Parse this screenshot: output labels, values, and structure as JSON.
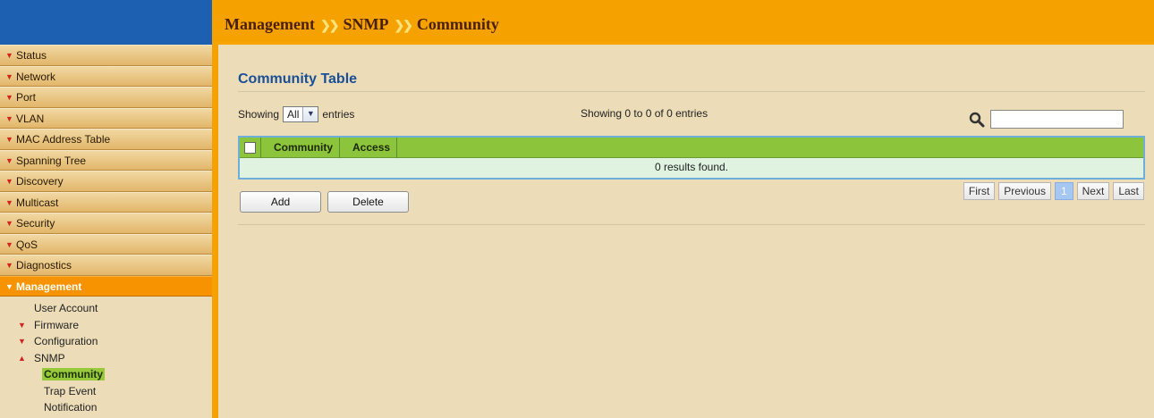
{
  "header": {
    "breadcrumb": [
      "Management",
      "SNMP",
      "Community"
    ]
  },
  "sidebar": {
    "items": [
      {
        "label": "Status"
      },
      {
        "label": "Network"
      },
      {
        "label": "Port"
      },
      {
        "label": "VLAN"
      },
      {
        "label": "MAC Address Table"
      },
      {
        "label": "Spanning Tree"
      },
      {
        "label": "Discovery"
      },
      {
        "label": "Multicast"
      },
      {
        "label": "Security"
      },
      {
        "label": "QoS"
      },
      {
        "label": "Diagnostics"
      },
      {
        "label": "Management"
      }
    ],
    "management_sub": {
      "user_account": "User Account",
      "firmware": "Firmware",
      "configuration": "Configuration",
      "snmp": "SNMP",
      "snmp_sub": {
        "community": "Community",
        "trap_event": "Trap Event",
        "notification": "Notification"
      }
    }
  },
  "main": {
    "title": "Community Table",
    "showing_prefix": "Showing",
    "page_size": "All",
    "entries_suffix": "entries",
    "showing_info": "Showing 0 to 0 of 0 entries",
    "search_value": "",
    "table": {
      "columns": [
        "Community",
        "Access"
      ],
      "empty_message": "0 results found."
    },
    "buttons": {
      "add": "Add",
      "delete": "Delete"
    },
    "pager": {
      "first": "First",
      "previous": "Previous",
      "current": "1",
      "next": "Next",
      "last": "Last"
    }
  },
  "colors": {
    "header_orange": "#f5a200",
    "logo_blue": "#1d5fb0",
    "table_header_green": "#8cc43c",
    "title_blue": "#1a4f97",
    "active_menu": "#f79300"
  }
}
